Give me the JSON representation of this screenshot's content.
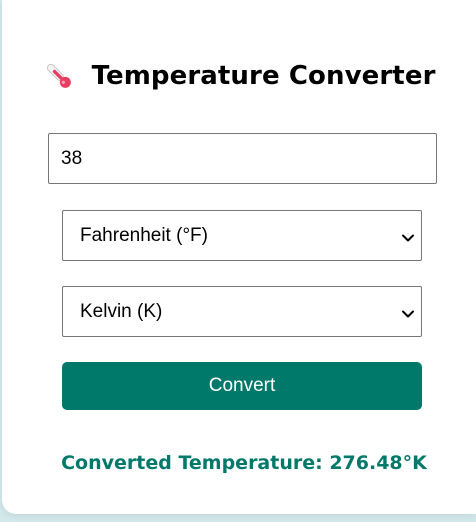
{
  "header": {
    "icon": "thermometer-icon",
    "title": "Temperature Converter"
  },
  "form": {
    "temperature_value": "38",
    "from_unit": "Fahrenheit (°F)",
    "to_unit": "Kelvin (K)",
    "convert_label": "Convert"
  },
  "result": {
    "text": "Converted Temperature: 276.48°K"
  },
  "colors": {
    "accent": "#00796b",
    "background": "#d2e8eb",
    "card": "#ffffff"
  }
}
